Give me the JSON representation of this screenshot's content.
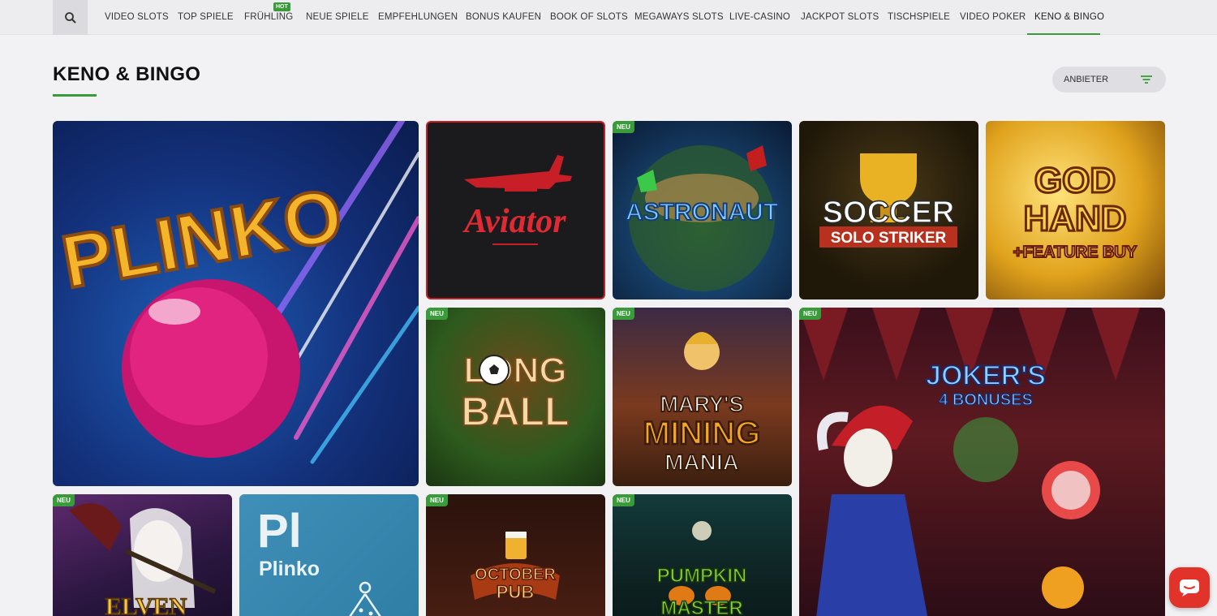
{
  "nav": {
    "search_icon": "search-icon",
    "items": [
      {
        "label": "VIDEO SLOTS"
      },
      {
        "label": "TOP SPIELE"
      },
      {
        "label": "FRÜHLING",
        "badge": "HOT"
      },
      {
        "label": "NEUE SPIELE"
      },
      {
        "label": "EMPFEHLUNGEN"
      },
      {
        "label": "BONUS KAUFEN"
      },
      {
        "label": "BOOK OF SLOTS"
      },
      {
        "label": "MEGAWAYS SLOTS"
      },
      {
        "label": "LIVE-CASINO"
      },
      {
        "label": "JACKPOT SLOTS"
      },
      {
        "label": "TISCHSPIELE"
      },
      {
        "label": "VIDEO POKER"
      },
      {
        "label": "KENO & BINGO",
        "active": true
      }
    ],
    "accent_color": "#3a9b3a"
  },
  "page": {
    "title": "KENO & BINGO",
    "filter_label": "ANBIETER",
    "filter_icon": "filter-icon"
  },
  "badges": {
    "new": "NEU"
  },
  "games": {
    "plinko": {
      "title": "PLINKO"
    },
    "aviator": {
      "title": "Aviator"
    },
    "astronaut": {
      "title": "ASTRONAUT"
    },
    "soccer": {
      "title": "SOCCER",
      "subtitle": "SOLO STRIKER"
    },
    "godhand": {
      "title_1": "GOD",
      "title_2": "HAND",
      "subtitle": "+FEATURE BUY"
    },
    "longball": {
      "title_1": "LONG",
      "title_2": "BALL"
    },
    "marys": {
      "title_1": "MARY'S",
      "title_2": "MINING",
      "title_3": "MANIA"
    },
    "joker": {
      "title": "JOKER'S",
      "subtitle": "4 BONUSES"
    },
    "elven": {
      "title": "ELVEN"
    },
    "plinko2": {
      "code": "Pl",
      "name": "Plinko"
    },
    "october": {
      "title_1": "OCTOBER",
      "title_2": "PUB"
    },
    "pumpkin": {
      "title_1": "PUMPKIN",
      "title_2": "MASTER"
    }
  },
  "chat": {
    "icon": "chat-icon"
  }
}
